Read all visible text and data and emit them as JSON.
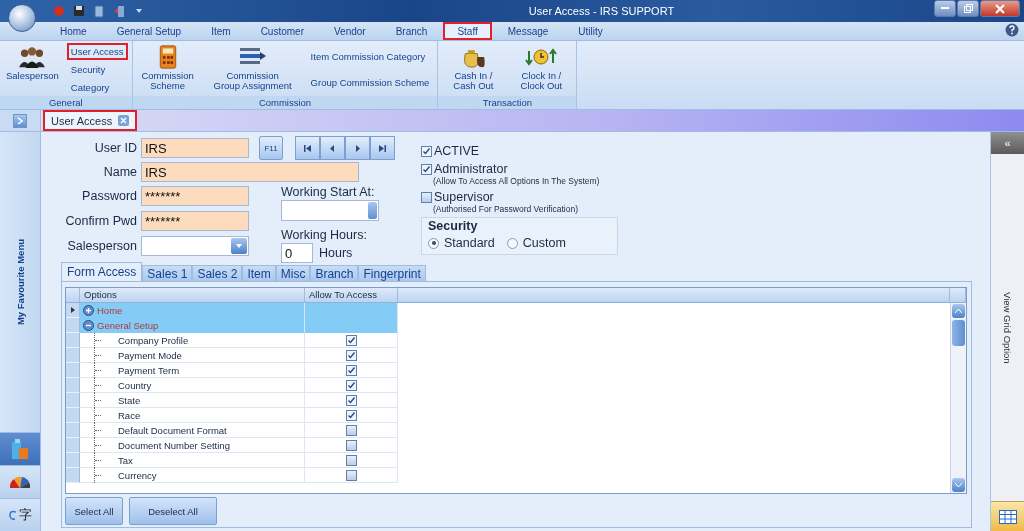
{
  "window": {
    "title": "User Access - IRS SUPPORT"
  },
  "menu_tabs": [
    {
      "label": "Home",
      "selected": false,
      "highlighted": false
    },
    {
      "label": "General Setup",
      "selected": false,
      "highlighted": false
    },
    {
      "label": "Item",
      "selected": false,
      "highlighted": false
    },
    {
      "label": "Customer",
      "selected": false,
      "highlighted": false
    },
    {
      "label": "Vendor",
      "selected": false,
      "highlighted": false
    },
    {
      "label": "Branch",
      "selected": false,
      "highlighted": false
    },
    {
      "label": "Staff",
      "selected": true,
      "highlighted": true
    },
    {
      "label": "Message",
      "selected": false,
      "highlighted": false
    },
    {
      "label": "Utility",
      "selected": false,
      "highlighted": false
    }
  ],
  "ribbon": {
    "groups": [
      {
        "title": "General",
        "items": [
          {
            "kind": "large",
            "label": "Salesperson",
            "highlighted": false
          },
          {
            "kind": "small",
            "label": "User Access",
            "highlighted": true
          },
          {
            "kind": "small",
            "label": "Security",
            "highlighted": false
          },
          {
            "kind": "small",
            "label": "Category",
            "highlighted": false
          }
        ]
      },
      {
        "title": "Commission",
        "items": [
          {
            "kind": "large",
            "label": "Commission Scheme",
            "highlighted": false
          },
          {
            "kind": "large",
            "label": "Commission Group Assignment",
            "highlighted": false
          },
          {
            "kind": "small",
            "label": "Item Commission Category",
            "highlighted": false
          },
          {
            "kind": "small",
            "label": "Group Commission Scheme",
            "highlighted": false
          }
        ]
      },
      {
        "title": "Transaction",
        "items": [
          {
            "kind": "large",
            "label": "Cash In / Cash Out",
            "highlighted": false
          },
          {
            "kind": "large",
            "label": "Clock In / Clock Out",
            "highlighted": false
          }
        ]
      }
    ]
  },
  "doc_tabs": [
    {
      "label": "User Access",
      "selected": true,
      "highlighted": true
    }
  ],
  "sidebar": {
    "title": "My Favourite Menu",
    "items": [
      {
        "selected": true
      },
      {
        "selected": false
      },
      {
        "selected": false,
        "glyph": "字"
      }
    ]
  },
  "form": {
    "user_id": {
      "label": "User ID",
      "value": "IRS"
    },
    "f11_button": "F11",
    "name": {
      "label": "Name",
      "value": "IRS"
    },
    "password": {
      "label": "Password",
      "value": "*******"
    },
    "confirm_pwd": {
      "label": "Confirm Pwd",
      "value": "*******"
    },
    "salesperson": {
      "label": "Salesperson"
    },
    "working_start": {
      "label": "Working Start At:"
    },
    "working_hours": {
      "label": "Working Hours:",
      "value": "0",
      "unit": "Hours"
    },
    "flags": [
      {
        "label": "ACTIVE",
        "checked": true
      },
      {
        "label": "Administrator",
        "note": "(Allow To Access All Options In The System)",
        "checked": true
      },
      {
        "label": "Supervisor",
        "note": "(Authorised For Password Verification)",
        "checked": false
      }
    ],
    "security": {
      "title": "Security",
      "options": [
        {
          "label": "Standard",
          "selected": true
        },
        {
          "label": "Custom",
          "selected": false
        }
      ]
    }
  },
  "sub_tabs": [
    {
      "label": "Form Access",
      "selected": true
    },
    {
      "label": "Sales 1",
      "selected": false
    },
    {
      "label": "Sales 2",
      "selected": false
    },
    {
      "label": "Item",
      "selected": false
    },
    {
      "label": "Misc",
      "selected": false
    },
    {
      "label": "Branch",
      "selected": false
    },
    {
      "label": "Fingerprint",
      "selected": false
    }
  ],
  "grid": {
    "columns": [
      "Options",
      "Allow To Access"
    ],
    "rows": [
      {
        "label": "Home",
        "selected": true,
        "expanded": false
      },
      {
        "label": "General Setup",
        "selected": false,
        "expanded": true,
        "children": [
          {
            "label": "Company Profile",
            "checked": true
          },
          {
            "label": "Payment Mode",
            "checked": true
          },
          {
            "label": "Payment Term",
            "checked": true
          },
          {
            "label": "Country",
            "checked": true
          },
          {
            "label": "State",
            "checked": true
          },
          {
            "label": "Race",
            "checked": true
          },
          {
            "label": "Default Document Format",
            "checked": false
          },
          {
            "label": "Document Number Setting",
            "checked": false
          },
          {
            "label": "Tax",
            "checked": false
          },
          {
            "label": "Currency",
            "checked": false
          }
        ]
      }
    ]
  },
  "buttons": [
    "Select All",
    "Deselect All"
  ],
  "right_panel": {
    "collapse": "«",
    "title": "View Grid Option"
  }
}
